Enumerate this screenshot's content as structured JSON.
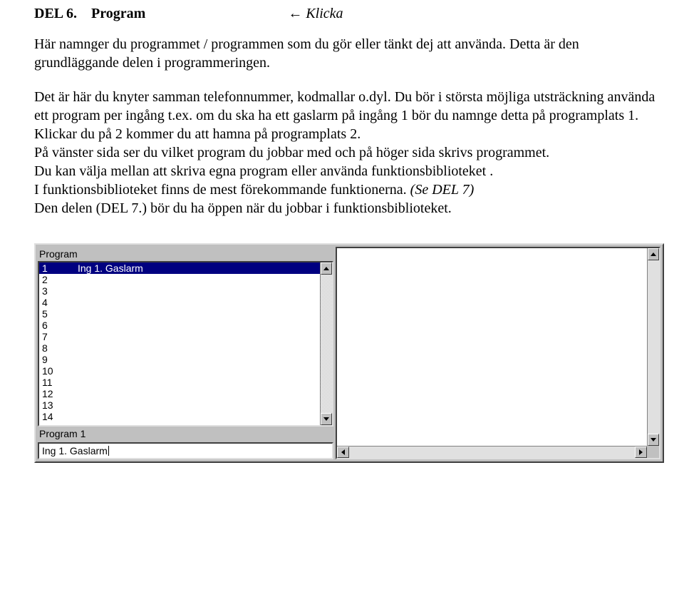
{
  "heading": {
    "part1": "DEL 6.",
    "part2": "Program",
    "klicka": "← Klicka"
  },
  "paragraphs": {
    "p1": "Här namnger du programmet / programmen som du gör eller tänkt dej att använda. Detta är den grundläggande delen i programmeringen.",
    "p2a": "Det är här du knyter samman telefonnummer, kodmallar o.dyl. Du bör i största möjliga utsträckning använda ett program per ingång  t.ex. om du ska ha ett gaslarm på ingång 1 bör du namnge detta på programplats 1. Klickar du på 2 kommer du att hamna på programplats 2.",
    "p3": "På vänster sida ser du vilket program du jobbar med och på höger sida skrivs programmet.",
    "p4": "Du kan välja mellan att skriva egna program eller använda funktionsbiblioteket .",
    "p5a": "I funktionsbiblioteket finns de mest förekommande funktionerna. ",
    "p5b": "(Se DEL 7)",
    "p6": "Den delen (DEL 7.) bör du ha öppen när du jobbar i funktionsbiblioteket."
  },
  "panel": {
    "program_label": "Program",
    "list": [
      {
        "num": "1",
        "text": "Ing 1. Gaslarm",
        "selected": true
      },
      {
        "num": "2",
        "text": "",
        "selected": false
      },
      {
        "num": "3",
        "text": "",
        "selected": false
      },
      {
        "num": "4",
        "text": "",
        "selected": false
      },
      {
        "num": "5",
        "text": "",
        "selected": false
      },
      {
        "num": "6",
        "text": "",
        "selected": false
      },
      {
        "num": "7",
        "text": "",
        "selected": false
      },
      {
        "num": "8",
        "text": "",
        "selected": false
      },
      {
        "num": "9",
        "text": "",
        "selected": false
      },
      {
        "num": "10",
        "text": "",
        "selected": false
      },
      {
        "num": "11",
        "text": "",
        "selected": false
      },
      {
        "num": "12",
        "text": "",
        "selected": false
      },
      {
        "num": "13",
        "text": "",
        "selected": false
      },
      {
        "num": "14",
        "text": "",
        "selected": false
      }
    ],
    "program_n_label": "Program 1",
    "input_value": "Ing 1. Gaslarm"
  }
}
